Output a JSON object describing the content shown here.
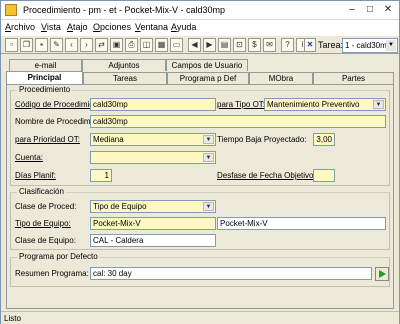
{
  "window": {
    "title": "Procedimiento - pm - et - Pocket-Mix-V - cald30mp"
  },
  "menu": [
    "Archivo",
    "Vista",
    "Atajo",
    "Opciones",
    "Ventana",
    "Ayuda"
  ],
  "menu_underline": [
    "A",
    "V",
    "A",
    "O",
    "V",
    "A"
  ],
  "toolbar": {
    "icons": [
      "new-icon",
      "copy-icon",
      "save-icon",
      "print-icon",
      "prev-icon",
      "next-icon",
      "transfer-icon",
      "save-disk-icon",
      "printer-icon",
      "view-icon",
      "table-icon",
      "folder-icon",
      "back-icon",
      "forward-icon",
      "report-icon",
      "lock-icon",
      "money-icon",
      "mail-icon",
      "help-icon",
      "info-icon",
      "close-icon"
    ],
    "tarea_label": "Tarea:",
    "tarea_value": "1 - cald30m"
  },
  "tabs_back": [
    "e-mail",
    "Adjuntos",
    "Campos de Usuario"
  ],
  "tabs_front": [
    "Principal",
    "Tareas",
    "Programa p Def",
    "MObra",
    "Partes"
  ],
  "procedimiento": {
    "legend": "Procedimiento",
    "codigo_label": "Código de Procedimien",
    "codigo_value": "cald30mp",
    "para_tipo_ot_label": "para Tipo OT:",
    "para_tipo_ot_value": "Mantenimiento Preventivo",
    "nombre_label": "Nombre de Procedimier",
    "nombre_value": "cald30mp",
    "para_prioridad_label": "para Prioridad OT:",
    "para_prioridad_value": "Mediana",
    "tiempo_baja_label": "Tiempo Baja Proyectado:",
    "tiempo_baja_value": "3,00",
    "cuenta_label": "Cuenta:",
    "cuenta_value": "",
    "dias_planif_label": "Días Planif:",
    "dias_planif_value": "1",
    "desfase_label": "Desfase de Fecha Objetivo:",
    "desfase_value": ""
  },
  "clasificacion": {
    "legend": "Clasificación",
    "clase_proced_label": "Clase de Proced:",
    "clase_proced_value": "Tipo de Equipo",
    "tipo_equipo_label": "Tipo de Equipo:",
    "tipo_equipo_value": "Pocket-Mix-V",
    "tipo_equipo_desc": "Pocket-Mix-V",
    "clase_equipo_label": "Clase de Equipo:",
    "clase_equipo_value": "CAL - Caldera"
  },
  "programa": {
    "legend": "Programa por Defecto",
    "resumen_label": "Resumen Programa:",
    "resumen_value": "cal: 30 day"
  },
  "status": {
    "text": "Listo"
  },
  "colors": {
    "required_field": "#fff8c0",
    "go_arrow": "#2a9a2a"
  }
}
